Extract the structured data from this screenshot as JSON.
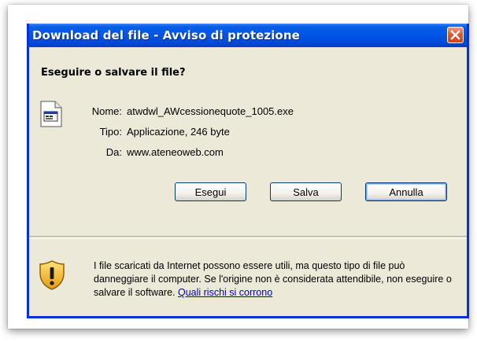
{
  "window": {
    "title": "Download del file - Avviso di protezione",
    "accent_color": "#0055e5",
    "close_icon": "close-icon"
  },
  "dialog": {
    "heading": "Eseguire o salvare il file?",
    "file_icon": "executable-file-icon",
    "fields": [
      {
        "label": "Nome:",
        "value": "atwdwl_AWcessionequote_1005.exe"
      },
      {
        "label": "Tipo:",
        "value": "Applicazione, 246 byte"
      },
      {
        "label": "Da:",
        "value": "www.ateneoweb.com"
      }
    ],
    "buttons": {
      "run": "Esegui",
      "save": "Salva",
      "cancel": "Annulla"
    }
  },
  "warning": {
    "icon": "shield-warning-icon",
    "text": "I file scaricati da Internet possono essere utili, ma questo tipo di file può danneggiare il computer. Se l'origine non è considerata attendibile, non eseguire o salvare il software. ",
    "link": "Quali rischi si corrono"
  }
}
